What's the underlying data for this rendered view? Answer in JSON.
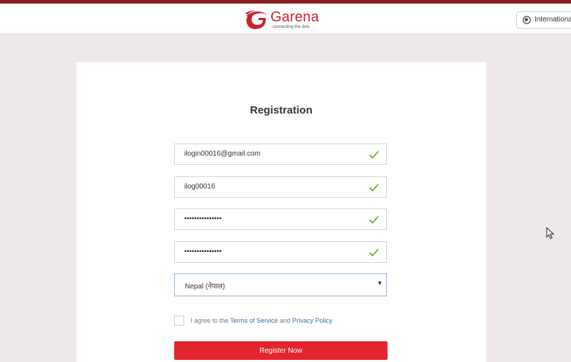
{
  "header": {
    "brand": "Garena",
    "tagline": "connecting the dots",
    "region_label": "International"
  },
  "form": {
    "title": "Registration",
    "email_value": "ilogin00016@gmail.com",
    "username_value": "ilog00016",
    "password_value": "•••••••••••••••",
    "confirm_password_value": "•••••••••••••••",
    "country_value": "Nepal (नेपाल)",
    "agree_prefix": "I agree to the ",
    "terms_link": "Terms of Service",
    "agree_and": " and ",
    "privacy_link": "Privacy Policy",
    "register_label": "Register Now"
  },
  "colors": {
    "brand_red": "#e3262d",
    "check_green": "#7cb342",
    "link_blue": "#3a6ea5"
  },
  "icons": {
    "field_status": "check-icon",
    "region": "globe-icon",
    "select": "caret-down-icon"
  }
}
